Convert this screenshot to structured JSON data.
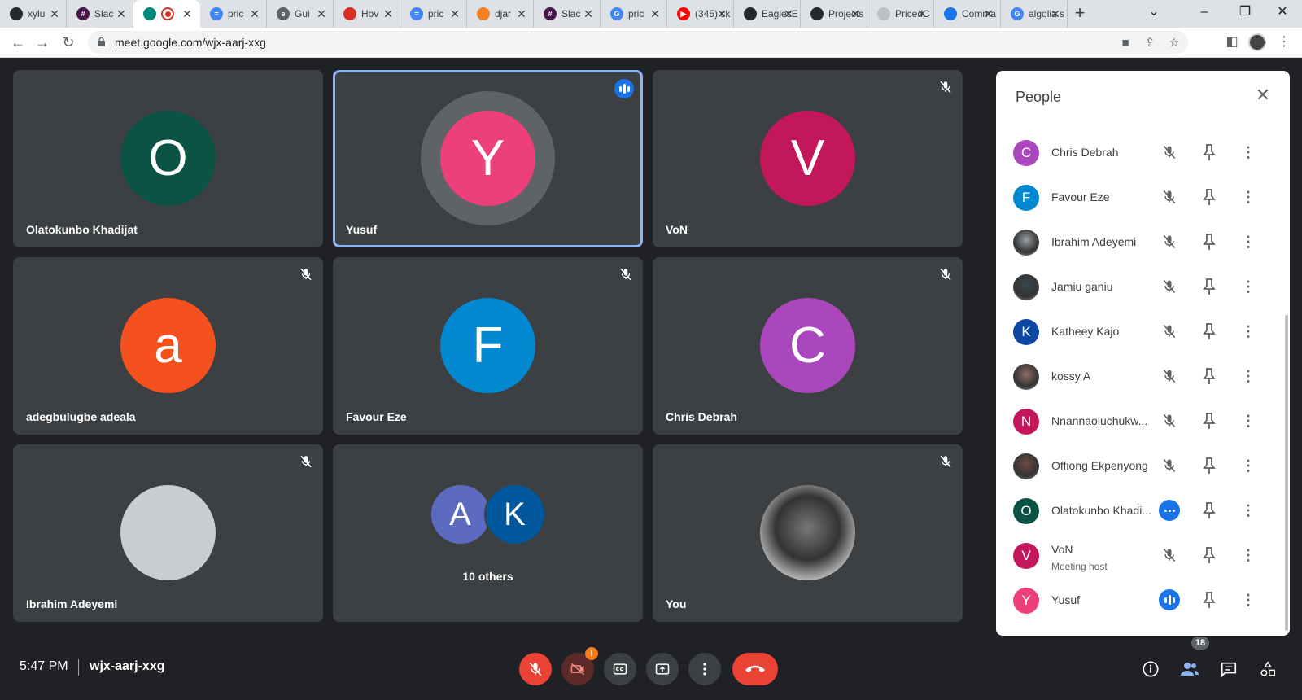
{
  "browser": {
    "tabs": [
      {
        "label": "xylu",
        "icon": "github-icon",
        "fav_color": "#24292f",
        "fav_glyph": ""
      },
      {
        "label": "Slac",
        "icon": "slack-icon",
        "fav_color": "#4a154b",
        "fav_glyph": "#"
      },
      {
        "label": "",
        "icon": "google-meet-icon",
        "fav_color": "#00897b",
        "fav_glyph": "",
        "active": true
      },
      {
        "label": "pric",
        "icon": "google-docs-icon",
        "fav_color": "#4285f4",
        "fav_glyph": "="
      },
      {
        "label": "Gui",
        "icon": "page-icon",
        "fav_color": "#5f6368",
        "fav_glyph": "e"
      },
      {
        "label": "Hov",
        "icon": "shield-icon",
        "fav_color": "#d93025",
        "fav_glyph": ""
      },
      {
        "label": "pric",
        "icon": "google-docs-icon",
        "fav_color": "#4285f4",
        "fav_glyph": "="
      },
      {
        "label": "djar",
        "icon": "stackoverflow-icon",
        "fav_color": "#f48024",
        "fav_glyph": ""
      },
      {
        "label": "Slac",
        "icon": "slack-icon",
        "fav_color": "#4a154b",
        "fav_glyph": "#"
      },
      {
        "label": "pric",
        "icon": "google-icon",
        "fav_color": "#4285f4",
        "fav_glyph": "G"
      },
      {
        "label": "(345) sk",
        "icon": "youtube-icon",
        "fav_color": "#ff0000",
        "fav_glyph": "▶"
      },
      {
        "label": "EaglesE",
        "icon": "github-icon",
        "fav_color": "#24292f",
        "fav_glyph": ""
      },
      {
        "label": "Projects",
        "icon": "github-icon",
        "fav_color": "#24292f",
        "fav_glyph": ""
      },
      {
        "label": "PricedC",
        "icon": "page-icon",
        "fav_color": "#bdc1c6",
        "fav_glyph": ""
      },
      {
        "label": "Comma",
        "icon": "clock-icon",
        "fav_color": "#1a73e8",
        "fav_glyph": ""
      },
      {
        "label": "algolia s",
        "icon": "google-icon",
        "fav_color": "#4285f4",
        "fav_glyph": "G"
      }
    ],
    "url": "meet.google.com/wjx-aarj-xxg"
  },
  "meeting": {
    "tiles": [
      {
        "name": "Olatokunbo Khadijat",
        "initial": "O",
        "color": "#0b5345",
        "muted": false,
        "speaking": false
      },
      {
        "name": "Yusuf",
        "initial": "Y",
        "color": "#ec407a",
        "muted": false,
        "speaking": true
      },
      {
        "name": "VoN",
        "initial": "V",
        "color": "#c2185b",
        "muted": true,
        "speaking": false
      },
      {
        "name": "adegbulugbe adeala",
        "initial": "a",
        "color": "#f4511e",
        "muted": true,
        "speaking": false
      },
      {
        "name": "Favour Eze",
        "initial": "F",
        "color": "#0288d1",
        "muted": true,
        "speaking": false
      },
      {
        "name": "Chris Debrah",
        "initial": "C",
        "color": "#ab47bc",
        "muted": true,
        "speaking": false
      },
      {
        "name": "Ibrahim Adeyemi",
        "initial": "",
        "color": "#c8cdd0",
        "muted": true,
        "speaking": false,
        "photo": true
      },
      {
        "name": "",
        "initial": "",
        "color": "",
        "muted": false,
        "speaking": false,
        "others": true
      },
      {
        "name": "You",
        "initial": "",
        "color": "#555555",
        "muted": true,
        "speaking": false,
        "photo": true
      }
    ],
    "others": {
      "initials": [
        "A",
        "K"
      ],
      "colors": [
        "#5c6bc0",
        "#01579b"
      ],
      "label": "10 others"
    }
  },
  "people_panel": {
    "title": "People",
    "participants": [
      {
        "name": "Chris Debrah",
        "initial": "C",
        "color": "#ab47bc"
      },
      {
        "name": "Favour Eze",
        "initial": "F",
        "color": "#0288d1"
      },
      {
        "name": "Ibrahim Adeyemi",
        "initial": "",
        "color": "#9aa0a6"
      },
      {
        "name": "Jamiu ganiu",
        "initial": "",
        "color": "#37474f"
      },
      {
        "name": "Katheey Kajo",
        "initial": "K",
        "color": "#0d47a1"
      },
      {
        "name": "kossy A",
        "initial": "",
        "color": "#8d6e63"
      },
      {
        "name": "Nnannaoluchukw...",
        "initial": "N",
        "color": "#c2185b"
      },
      {
        "name": "Offiong Ekpenyong",
        "initial": "",
        "color": "#6d4c41"
      },
      {
        "name": "Olatokunbo Khadi...",
        "initial": "O",
        "color": "#0b5345",
        "status": "active"
      },
      {
        "name": "VoN",
        "initial": "V",
        "color": "#c2185b",
        "subtitle": "Meeting host"
      },
      {
        "name": "Yusuf",
        "initial": "Y",
        "color": "#ec407a",
        "status": "speaking"
      }
    ]
  },
  "bottom_bar": {
    "time": "5:47 PM",
    "meeting_code": "wjx-aarj-xxg",
    "people_count": "18",
    "camera_warning": "!"
  }
}
